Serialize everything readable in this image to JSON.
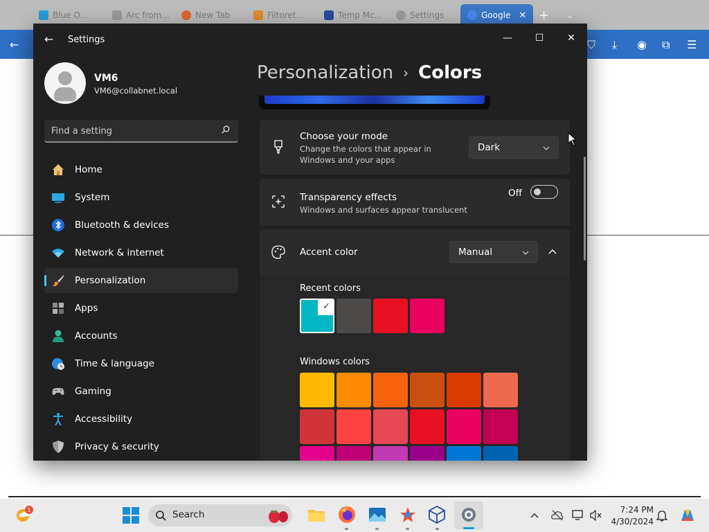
{
  "background_browser": {
    "tabs": [
      {
        "label": "Blue O...",
        "color": "#2a9bd8"
      },
      {
        "label": "Arc from...",
        "color": "#9a9a9a"
      },
      {
        "label": "New Tab",
        "color": "#e0642e"
      },
      {
        "label": "Filtoret...",
        "color": "#e08a2e"
      },
      {
        "label": "Temp Mc...",
        "color": "#2a4a9c"
      },
      {
        "label": "Settings",
        "color": "#9a9a9a"
      },
      {
        "label": "Google",
        "color": "#4a8af0"
      }
    ],
    "new_tab_glyph": "+"
  },
  "window": {
    "app_title": "Settings",
    "controls": {
      "minimize": "—",
      "maximize": "☐",
      "close": "✕"
    }
  },
  "user": {
    "name": "VM6",
    "email": "VM6@collabnet.local"
  },
  "search": {
    "placeholder": "Find a setting"
  },
  "nav": {
    "items": [
      {
        "label": "Home",
        "icon": "home-icon"
      },
      {
        "label": "System",
        "icon": "system-icon"
      },
      {
        "label": "Bluetooth & devices",
        "icon": "bluetooth-icon"
      },
      {
        "label": "Network & internet",
        "icon": "wifi-icon"
      },
      {
        "label": "Personalization",
        "icon": "brush-icon",
        "selected": true
      },
      {
        "label": "Apps",
        "icon": "apps-icon"
      },
      {
        "label": "Accounts",
        "icon": "person-icon"
      },
      {
        "label": "Time & language",
        "icon": "globe-clock-icon"
      },
      {
        "label": "Gaming",
        "icon": "controller-icon"
      },
      {
        "label": "Accessibility",
        "icon": "accessibility-icon"
      },
      {
        "label": "Privacy & security",
        "icon": "shield-icon"
      }
    ]
  },
  "breadcrumb": {
    "parent": "Personalization",
    "separator": "›",
    "current": "Colors"
  },
  "mode_card": {
    "title": "Choose your mode",
    "desc_line1": "Change the colors that appear in",
    "desc_line2": "Windows and your apps",
    "value": "Dark"
  },
  "transparency_card": {
    "title": "Transparency effects",
    "desc": "Windows and surfaces appear translucent",
    "state_label": "Off"
  },
  "accent_card": {
    "title": "Accent color",
    "value": "Manual",
    "expanded": true
  },
  "recent_colors": {
    "label": "Recent colors",
    "colors": [
      "#00b7c3",
      "#4c4a48",
      "#e81123",
      "#ea005e"
    ],
    "selected_index": 0
  },
  "windows_colors": {
    "label": "Windows colors",
    "rows": [
      [
        "#ffb900",
        "#ff8c00",
        "#f7630c",
        "#ca5010",
        "#da3b01",
        "#ef6950"
      ],
      [
        "#d13438",
        "#ff4343",
        "#e74856",
        "#e81123",
        "#ea005e",
        "#c30052"
      ],
      [
        "#e3008c",
        "#bf0077",
        "#c239b3",
        "#9a0089",
        "#0078d7",
        "#0063b1"
      ]
    ]
  },
  "taskbar": {
    "search_label": "Search",
    "time": "7:24 PM",
    "date": "4/30/2024",
    "notification_badge": "1"
  }
}
